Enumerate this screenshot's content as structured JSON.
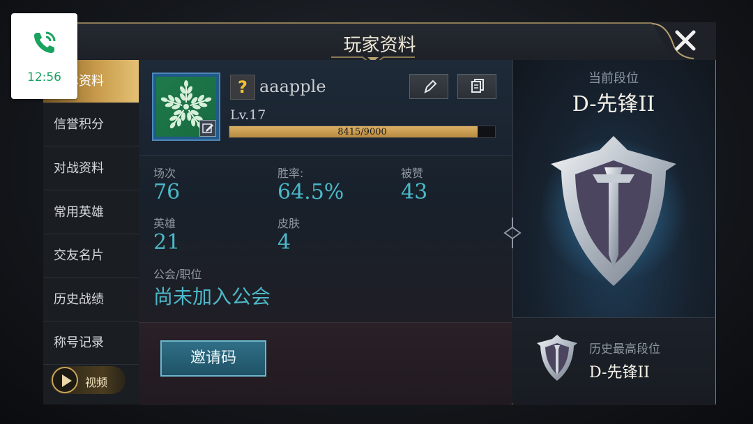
{
  "status": {
    "call_time": "12:56"
  },
  "window": {
    "title": "玩家资料"
  },
  "sidebar": {
    "items": [
      {
        "label": "基本资料"
      },
      {
        "label": "信誉积分"
      },
      {
        "label": "对战资料"
      },
      {
        "label": "常用英雄"
      },
      {
        "label": "交友名片"
      },
      {
        "label": "历史战绩"
      },
      {
        "label": "称号记录"
      }
    ],
    "active_index": 0,
    "video_label": "视频"
  },
  "profile": {
    "help_badge": "?",
    "name": "aaapple",
    "level": "Lv.17",
    "xp": {
      "text": "8415/9000",
      "current": 8415,
      "max": 9000
    }
  },
  "stats": {
    "matches": {
      "label": "场次",
      "value": "76"
    },
    "win_rate": {
      "label": "胜率:",
      "value": "64.5%"
    },
    "likes": {
      "label": "被赞",
      "value": "43"
    },
    "heroes": {
      "label": "英雄",
      "value": "21"
    },
    "skins": {
      "label": "皮肤",
      "value": "4"
    },
    "guild": {
      "label": "公会/职位",
      "value": "尚未加入公会"
    }
  },
  "invite": {
    "label": "邀请码"
  },
  "rank": {
    "current_label": "当前段位",
    "current": "D-先锋II",
    "best_label": "历史最高段位",
    "best": "D-先锋II"
  },
  "colors": {
    "accent_gold": "#c79a4a",
    "stat_teal": "#4cb8c8",
    "call_green": "#1aa260"
  }
}
